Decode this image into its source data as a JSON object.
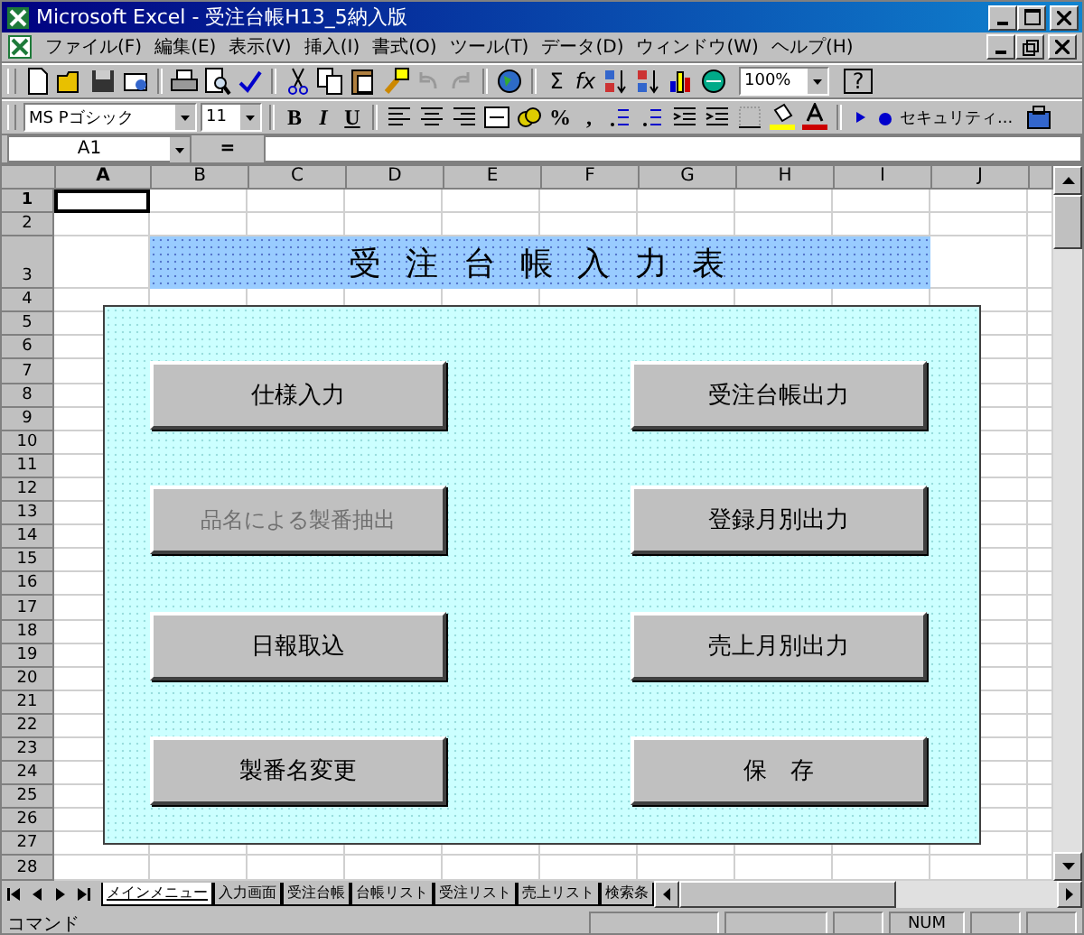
{
  "window": {
    "title": "Microsoft Excel - 受注台帳H13_5納入版"
  },
  "menu": [
    "ファイル(F)",
    "編集(E)",
    "表示(V)",
    "挿入(I)",
    "書式(O)",
    "ツール(T)",
    "データ(D)",
    "ウィンドウ(W)",
    "ヘルプ(H)"
  ],
  "standard_toolbar": {
    "sum": "Σ",
    "function": "fx",
    "zoom": "100%",
    "help": "?"
  },
  "formatting_toolbar": {
    "font": "MS Pゴシック",
    "size": "11",
    "bold": "B",
    "italic": "I",
    "underline": "U",
    "percent": "%",
    "comma": ",",
    "security": "セキュリティ..."
  },
  "formula_bar": {
    "name_box": "A1",
    "equals": "="
  },
  "columns": [
    "A",
    "B",
    "C",
    "D",
    "E",
    "F",
    "G",
    "H",
    "I",
    "J"
  ],
  "rows": [
    "1",
    "2",
    "3",
    "4",
    "5",
    "6",
    "7",
    "8",
    "9",
    "10",
    "11",
    "12",
    "13",
    "14",
    "15",
    "16",
    "17",
    "18",
    "19",
    "20",
    "21",
    "22",
    "23",
    "24",
    "25",
    "26",
    "27",
    "28"
  ],
  "sheet_title": "受 注 台 帳 入 力 表",
  "menu_buttons": [
    {
      "label": "仕様入力",
      "disabled": false
    },
    {
      "label": "受注台帳出力",
      "disabled": false
    },
    {
      "label": "品名による製番抽出",
      "disabled": true
    },
    {
      "label": "登録月別出力",
      "disabled": false
    },
    {
      "label": "日報取込",
      "disabled": false
    },
    {
      "label": "売上月別出力",
      "disabled": false
    },
    {
      "label": "製番名変更",
      "disabled": false
    },
    {
      "label": "保　存",
      "disabled": false
    }
  ],
  "sheet_tabs": [
    {
      "label": "メインメニュー",
      "selected": true
    },
    {
      "label": "入力画面",
      "selected": false
    },
    {
      "label": "受注台帳",
      "selected": false
    },
    {
      "label": "台帳リスト",
      "selected": false
    },
    {
      "label": "受注リスト",
      "selected": false
    },
    {
      "label": "売上リスト",
      "selected": false
    },
    {
      "label": "検索条",
      "selected": false
    }
  ],
  "status_bar": {
    "mode": "コマンド",
    "num": "NUM"
  }
}
